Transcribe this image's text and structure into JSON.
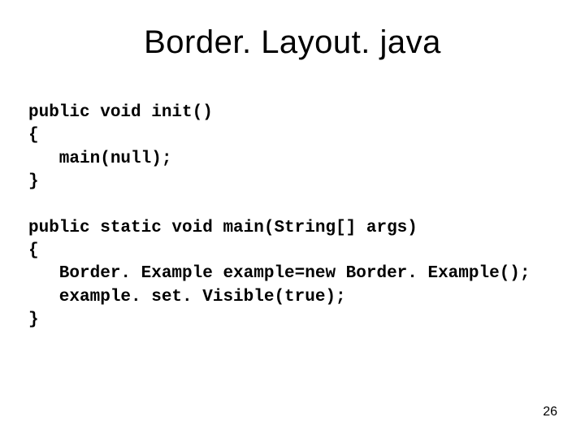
{
  "slide": {
    "title": "Border. Layout. java",
    "code": "public void init()\n{\n   main(null);\n}\n\npublic static void main(String[] args)\n{\n   Border. Example example=new Border. Example();\n   example. set. Visible(true);\n}",
    "page_number": "26"
  }
}
